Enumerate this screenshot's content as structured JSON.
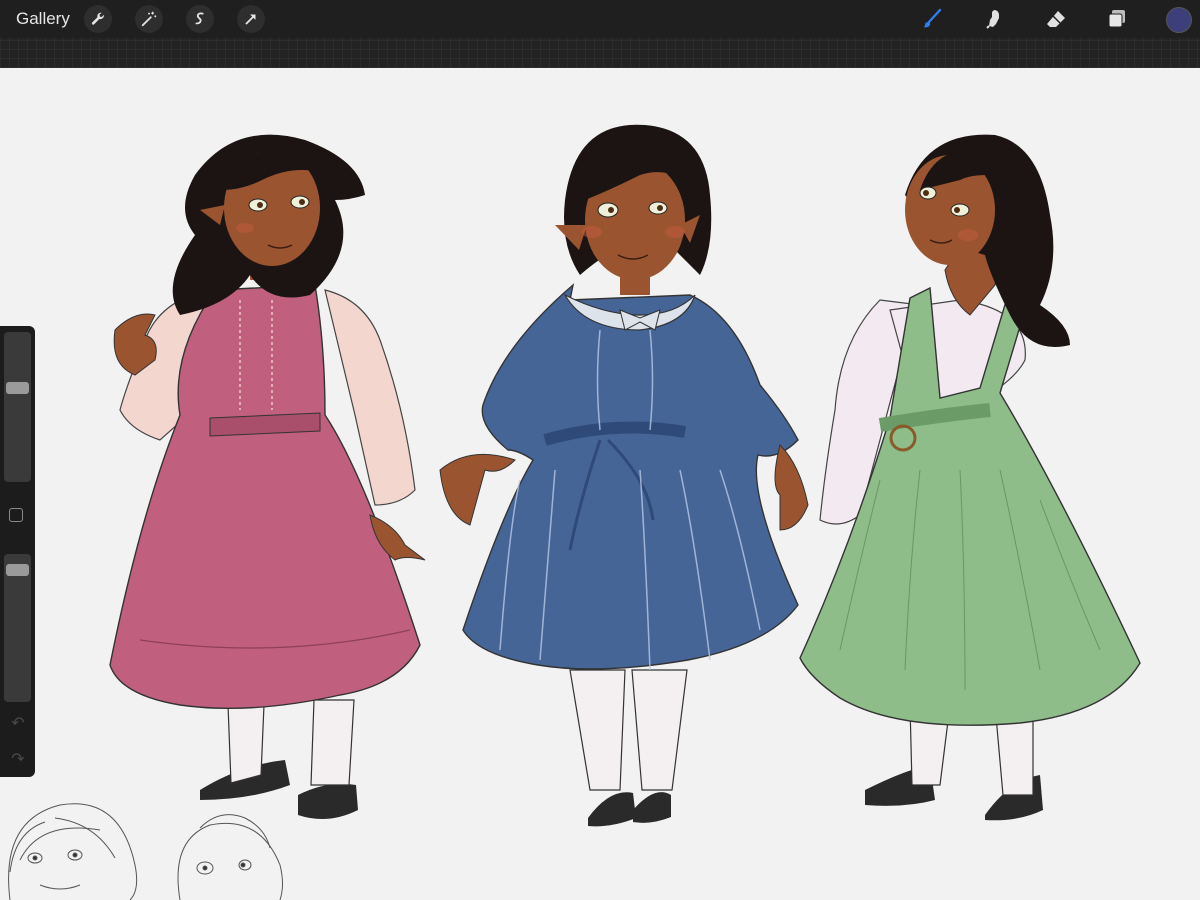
{
  "app": {
    "gallery_label": "Gallery",
    "left_tools": [
      "wrench-icon",
      "magic-wand-icon",
      "selection-icon",
      "transform-arrow-icon"
    ],
    "right_tools": [
      "brush-icon",
      "smudge-icon",
      "eraser-icon",
      "layers-icon"
    ],
    "active_tool": "brush-icon",
    "active_tool_color": "#2f7ef0",
    "current_color": "#3d3f7a"
  },
  "sidebar": {
    "brush_size_level": 0.35,
    "opacity_level": 0.05,
    "undo_icon": "undo-icon",
    "redo_icon": "redo-icon"
  },
  "canvas": {
    "background": "#f2f2f2",
    "figures": [
      {
        "name": "pink-dress-figure",
        "dress_color": "#c0607e",
        "blouse_color": "#f3d6cd"
      },
      {
        "name": "blue-dress-figure",
        "dress_color": "#456597",
        "collar_color": "#dde3ea"
      },
      {
        "name": "green-dress-figure",
        "dress_color": "#8fbd8a",
        "blouse_color": "#f3e9f1"
      }
    ],
    "sketches": [
      "sketch-head-left",
      "sketch-head-right"
    ]
  }
}
